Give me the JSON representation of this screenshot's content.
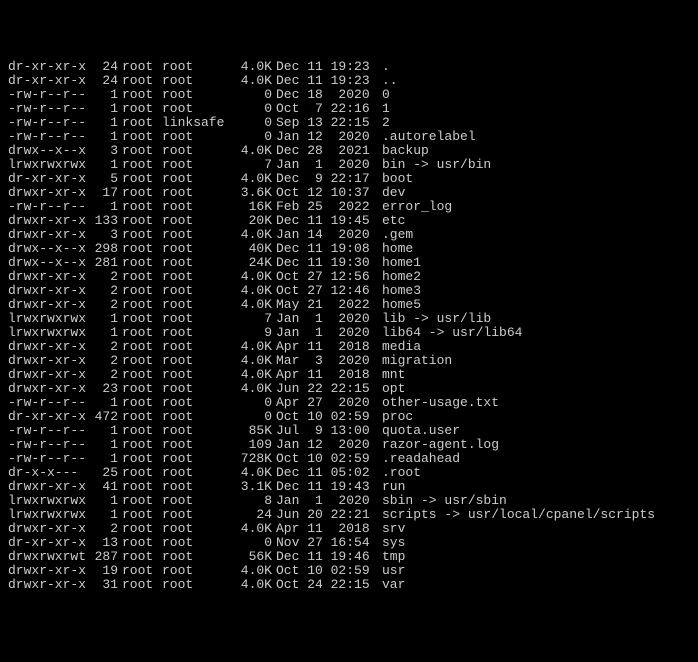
{
  "listing": [
    {
      "perm": "dr-xr-xr-x",
      "links": "24",
      "owner": "root",
      "group": "root",
      "size": "4.0K",
      "date": "Dec 11 19:23",
      "name": "."
    },
    {
      "perm": "dr-xr-xr-x",
      "links": "24",
      "owner": "root",
      "group": "root",
      "size": "4.0K",
      "date": "Dec 11 19:23",
      "name": ".."
    },
    {
      "perm": "-rw-r--r--",
      "links": "1",
      "owner": "root",
      "group": "root",
      "size": "0",
      "date": "Dec 18  2020",
      "name": "0"
    },
    {
      "perm": "-rw-r--r--",
      "links": "1",
      "owner": "root",
      "group": "root",
      "size": "0",
      "date": "Oct  7 22:16",
      "name": "1"
    },
    {
      "perm": "-rw-r--r--",
      "links": "1",
      "owner": "root",
      "group": "linksafe",
      "size": "0",
      "date": "Sep 13 22:15",
      "name": "2"
    },
    {
      "perm": "-rw-r--r--",
      "links": "1",
      "owner": "root",
      "group": "root",
      "size": "0",
      "date": "Jan 12  2020",
      "name": ".autorelabel"
    },
    {
      "perm": "drwx--x--x",
      "links": "3",
      "owner": "root",
      "group": "root",
      "size": "4.0K",
      "date": "Dec 28  2021",
      "name": "backup"
    },
    {
      "perm": "lrwxrwxrwx",
      "links": "1",
      "owner": "root",
      "group": "root",
      "size": "7",
      "date": "Jan  1  2020",
      "name": "bin -> usr/bin"
    },
    {
      "perm": "dr-xr-xr-x",
      "links": "5",
      "owner": "root",
      "group": "root",
      "size": "4.0K",
      "date": "Dec  9 22:17",
      "name": "boot"
    },
    {
      "perm": "drwxr-xr-x",
      "links": "17",
      "owner": "root",
      "group": "root",
      "size": "3.6K",
      "date": "Oct 12 10:37",
      "name": "dev"
    },
    {
      "perm": "-rw-r--r--",
      "links": "1",
      "owner": "root",
      "group": "root",
      "size": "16K",
      "date": "Feb 25  2022",
      "name": "error_log"
    },
    {
      "perm": "drwxr-xr-x",
      "links": "133",
      "owner": "root",
      "group": "root",
      "size": "20K",
      "date": "Dec 11 19:45",
      "name": "etc"
    },
    {
      "perm": "drwxr-xr-x",
      "links": "3",
      "owner": "root",
      "group": "root",
      "size": "4.0K",
      "date": "Jan 14  2020",
      "name": ".gem"
    },
    {
      "perm": "drwx--x--x",
      "links": "298",
      "owner": "root",
      "group": "root",
      "size": "40K",
      "date": "Dec 11 19:08",
      "name": "home"
    },
    {
      "perm": "drwx--x--x",
      "links": "281",
      "owner": "root",
      "group": "root",
      "size": "24K",
      "date": "Dec 11 19:30",
      "name": "home1"
    },
    {
      "perm": "drwxr-xr-x",
      "links": "2",
      "owner": "root",
      "group": "root",
      "size": "4.0K",
      "date": "Oct 27 12:56",
      "name": "home2"
    },
    {
      "perm": "drwxr-xr-x",
      "links": "2",
      "owner": "root",
      "group": "root",
      "size": "4.0K",
      "date": "Oct 27 12:46",
      "name": "home3"
    },
    {
      "perm": "drwxr-xr-x",
      "links": "2",
      "owner": "root",
      "group": "root",
      "size": "4.0K",
      "date": "May 21  2022",
      "name": "home5"
    },
    {
      "perm": "lrwxrwxrwx",
      "links": "1",
      "owner": "root",
      "group": "root",
      "size": "7",
      "date": "Jan  1  2020",
      "name": "lib -> usr/lib"
    },
    {
      "perm": "lrwxrwxrwx",
      "links": "1",
      "owner": "root",
      "group": "root",
      "size": "9",
      "date": "Jan  1  2020",
      "name": "lib64 -> usr/lib64"
    },
    {
      "perm": "drwxr-xr-x",
      "links": "2",
      "owner": "root",
      "group": "root",
      "size": "4.0K",
      "date": "Apr 11  2018",
      "name": "media"
    },
    {
      "perm": "drwxr-xr-x",
      "links": "2",
      "owner": "root",
      "group": "root",
      "size": "4.0K",
      "date": "Mar  3  2020",
      "name": "migration"
    },
    {
      "perm": "drwxr-xr-x",
      "links": "2",
      "owner": "root",
      "group": "root",
      "size": "4.0K",
      "date": "Apr 11  2018",
      "name": "mnt"
    },
    {
      "perm": "drwxr-xr-x",
      "links": "23",
      "owner": "root",
      "group": "root",
      "size": "4.0K",
      "date": "Jun 22 22:15",
      "name": "opt"
    },
    {
      "perm": "-rw-r--r--",
      "links": "1",
      "owner": "root",
      "group": "root",
      "size": "0",
      "date": "Apr 27  2020",
      "name": "other-usage.txt"
    },
    {
      "perm": "dr-xr-xr-x",
      "links": "472",
      "owner": "root",
      "group": "root",
      "size": "0",
      "date": "Oct 10 02:59",
      "name": "proc"
    },
    {
      "perm": "-rw-r--r--",
      "links": "1",
      "owner": "root",
      "group": "root",
      "size": "85K",
      "date": "Jul  9 13:00",
      "name": "quota.user"
    },
    {
      "perm": "-rw-r--r--",
      "links": "1",
      "owner": "root",
      "group": "root",
      "size": "109",
      "date": "Jan 12  2020",
      "name": "razor-agent.log"
    },
    {
      "perm": "-rw-r--r--",
      "links": "1",
      "owner": "root",
      "group": "root",
      "size": "728K",
      "date": "Oct 10 02:59",
      "name": ".readahead"
    },
    {
      "perm": "dr-x-x---",
      "links": "25",
      "owner": "root",
      "group": "root",
      "size": "4.0K",
      "date": "Dec 11 05:02",
      "name": ".root"
    },
    {
      "perm": "drwxr-xr-x",
      "links": "41",
      "owner": "root",
      "group": "root",
      "size": "3.1K",
      "date": "Dec 11 19:43",
      "name": "run"
    },
    {
      "perm": "lrwxrwxrwx",
      "links": "1",
      "owner": "root",
      "group": "root",
      "size": "8",
      "date": "Jan  1  2020",
      "name": "sbin -> usr/sbin"
    },
    {
      "perm": "lrwxrwxrwx",
      "links": "1",
      "owner": "root",
      "group": "root",
      "size": "24",
      "date": "Jun 20 22:21",
      "name": "scripts -> usr/local/cpanel/scripts"
    },
    {
      "perm": "drwxr-xr-x",
      "links": "2",
      "owner": "root",
      "group": "root",
      "size": "4.0K",
      "date": "Apr 11  2018",
      "name": "srv"
    },
    {
      "perm": "dr-xr-xr-x",
      "links": "13",
      "owner": "root",
      "group": "root",
      "size": "0",
      "date": "Nov 27 16:54",
      "name": "sys"
    },
    {
      "perm": "drwxrwxrwt",
      "links": "287",
      "owner": "root",
      "group": "root",
      "size": "56K",
      "date": "Dec 11 19:46",
      "name": "tmp"
    },
    {
      "perm": "drwxr-xr-x",
      "links": "19",
      "owner": "root",
      "group": "root",
      "size": "4.0K",
      "date": "Oct 10 02:59",
      "name": "usr"
    },
    {
      "perm": "drwxr-xr-x",
      "links": "31",
      "owner": "root",
      "group": "root",
      "size": "4.0K",
      "date": "Oct 24 22:15",
      "name": "var"
    }
  ]
}
